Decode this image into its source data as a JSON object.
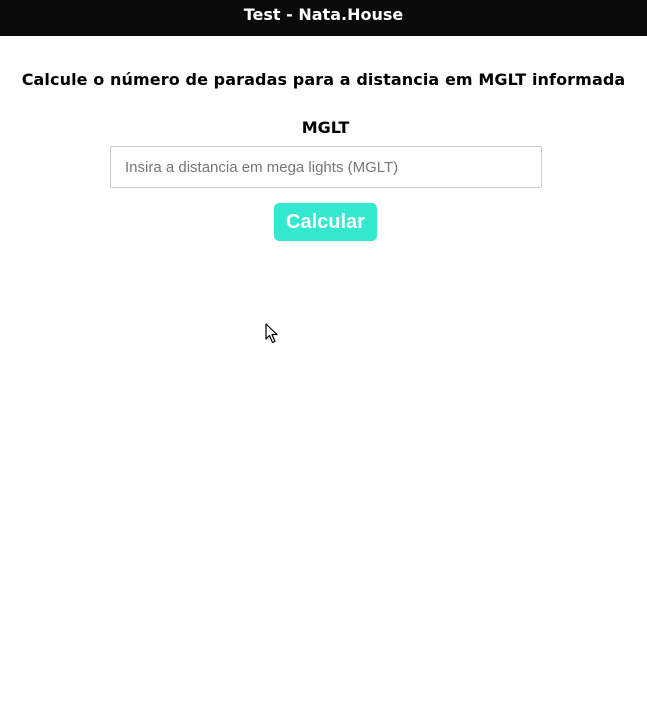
{
  "header": {
    "title": "Test - Nata.House"
  },
  "main": {
    "heading": "Calcule o número de paradas para a distancia em MGLT informada",
    "field_label": "MGLT",
    "input": {
      "value": "",
      "placeholder": "Insira a distancia em mega lights (MGLT)"
    },
    "submit_label": "Calcular"
  },
  "colors": {
    "header_bg": "#0a0a0a",
    "button_bg": "#34e8cf",
    "button_text": "#ffffff"
  },
  "icons": {
    "cursor": "mouse-pointer-icon"
  }
}
